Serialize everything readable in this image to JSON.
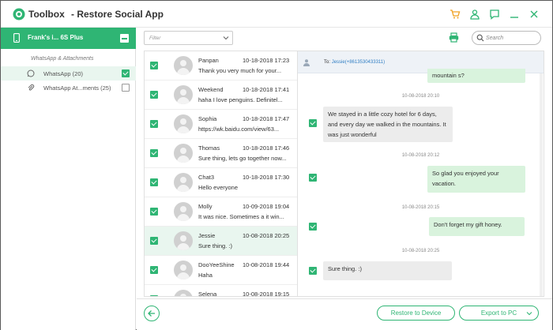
{
  "app": {
    "brand": "Toolbox",
    "title": "- Restore Social App"
  },
  "titlebar_icons": [
    "cart-icon",
    "user-icon",
    "feedback-icon",
    "minimize-icon",
    "close-icon"
  ],
  "colors": {
    "accent": "#2fb574",
    "orange": "#f0a020",
    "selected_bg": "#e9f6ef",
    "incoming_bubble": "#ececec",
    "outgoing_bubble": "#d9f3dd"
  },
  "sidebar": {
    "device_name": "Frank's i... 6S Plus",
    "section_label": "WhatsApp & Attachments",
    "items": [
      {
        "label": "WhatsApp (20)",
        "icon": "whatsapp-icon",
        "checked": true
      },
      {
        "label": "WhatsApp At...ments (25)",
        "icon": "paperclip-icon",
        "checked": false
      }
    ]
  },
  "toolbar": {
    "filter_placeholder": "Filter",
    "search_placeholder": "Search"
  },
  "contacts": [
    {
      "name": "Panpan",
      "date": "10-18-2018 17:23",
      "preview": "Thank you very much for your..."
    },
    {
      "name": "Weekend",
      "date": "10-18-2018 17:41",
      "preview": "haha I love penguins. Definitel..."
    },
    {
      "name": "Sophia",
      "date": "10-18-2018 17:47",
      "preview": "https://wk.baidu.com/view/63..."
    },
    {
      "name": "Thomas",
      "date": "10-18-2018 17:46",
      "preview": "Sure thing, lets go together now..."
    },
    {
      "name": "Chat3",
      "date": "10-18-2018 17:30",
      "preview": "Hello everyone"
    },
    {
      "name": "Molly",
      "date": "10-09-2018 19:04",
      "preview": "It was nice. Sometimes a it win..."
    },
    {
      "name": "Jessie",
      "date": "10-08-2018 20:25",
      "preview": "Sure thing. :)"
    },
    {
      "name": "DooYeeShine",
      "date": "10-08-2018 19:44",
      "preview": "Haha"
    },
    {
      "name": "Selena",
      "date": "10-08-2018 19:15",
      "preview": ""
    }
  ],
  "conversation": {
    "to_label": "To:",
    "recipient": "Jessie(+8613530433311)",
    "messages": [
      {
        "dir": "out",
        "text": "mountain s?",
        "time": "10-08-2018 20:10"
      },
      {
        "dir": "in",
        "text": "We stayed in a little cozy hotel for 6 days, and every day we walked in the mountains. It was just wonderful",
        "time": "10-08-2018 20:12"
      },
      {
        "dir": "out",
        "text": "So glad you enjoyed your vacation.",
        "time": "10-08-2018 20:15"
      },
      {
        "dir": "out",
        "text": "Don't forget my gift honey.",
        "time": "10-08-2018 20:25"
      },
      {
        "dir": "in",
        "text": "Sure thing. :)"
      }
    ]
  },
  "actions": {
    "restore_label": "Restore to Device",
    "export_label": "Export to PC"
  }
}
